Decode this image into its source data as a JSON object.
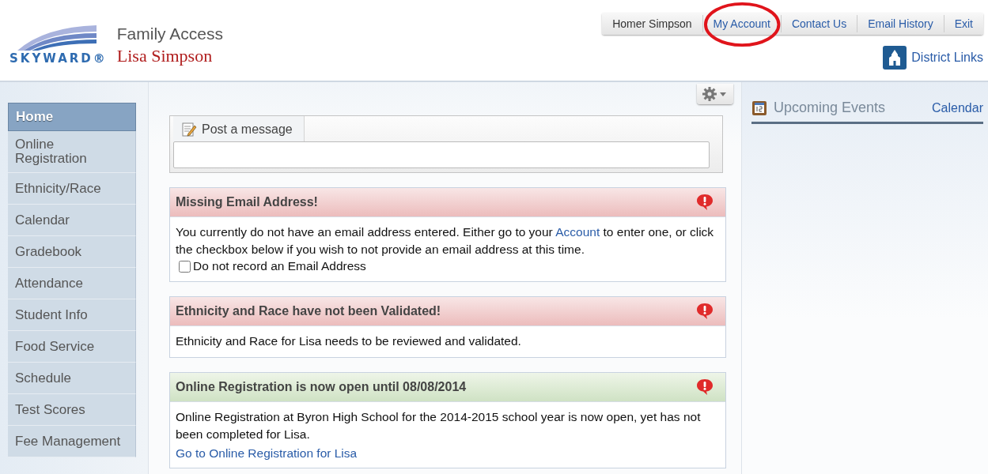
{
  "logo": {
    "wordmark": "SKYWARD®"
  },
  "header": {
    "app_title": "Family Access",
    "student_name": "Lisa Simpson"
  },
  "top_nav": [
    {
      "label": "Homer Simpson",
      "kind": "user"
    },
    {
      "label": "My Account",
      "kind": "link",
      "circled": true
    },
    {
      "label": "Contact Us",
      "kind": "link"
    },
    {
      "label": "Email History",
      "kind": "link"
    },
    {
      "label": "Exit",
      "kind": "link"
    }
  ],
  "district_links": {
    "label": "District Links"
  },
  "sidebar": {
    "items": [
      {
        "label": "Home",
        "selected": true
      },
      {
        "label": "Online Registration",
        "selected": false
      },
      {
        "label": "Ethnicity/Race",
        "selected": false
      },
      {
        "label": "Calendar",
        "selected": false
      },
      {
        "label": "Gradebook",
        "selected": false
      },
      {
        "label": "Attendance",
        "selected": false
      },
      {
        "label": "Student Info",
        "selected": false
      },
      {
        "label": "Food Service",
        "selected": false
      },
      {
        "label": "Schedule",
        "selected": false
      },
      {
        "label": "Test Scores",
        "selected": false
      },
      {
        "label": "Fee Management",
        "selected": false
      }
    ]
  },
  "post_message": {
    "tab_label": "Post a message"
  },
  "alerts": [
    {
      "kind": "error",
      "title": "Missing Email Address!",
      "body": [
        {
          "kind": "text",
          "text": "You currently do not have an email address entered. Either go to your "
        },
        {
          "kind": "link",
          "text": "Account"
        },
        {
          "kind": "text",
          "text": " to enter one, or click the checkbox below if you wish to not provide an email address at this time."
        }
      ],
      "checkbox": {
        "label": "Do not record an Email Address",
        "checked": false
      }
    },
    {
      "kind": "error",
      "title": "Ethnicity and Race have not been Validated!",
      "body": [
        {
          "kind": "text",
          "text": "Ethnicity and Race for Lisa needs to be reviewed and validated."
        }
      ]
    },
    {
      "kind": "success",
      "title": "Online Registration is now open until 08/08/2014",
      "body": [
        {
          "kind": "text",
          "text": "Online Registration at Byron High School for the 2014-2015 school year is now open, yet has not been completed for Lisa."
        }
      ],
      "link": "Go to Online Registration for Lisa"
    }
  ],
  "events_panel": {
    "title": "Upcoming Events",
    "calendar_link": "Calendar"
  }
}
